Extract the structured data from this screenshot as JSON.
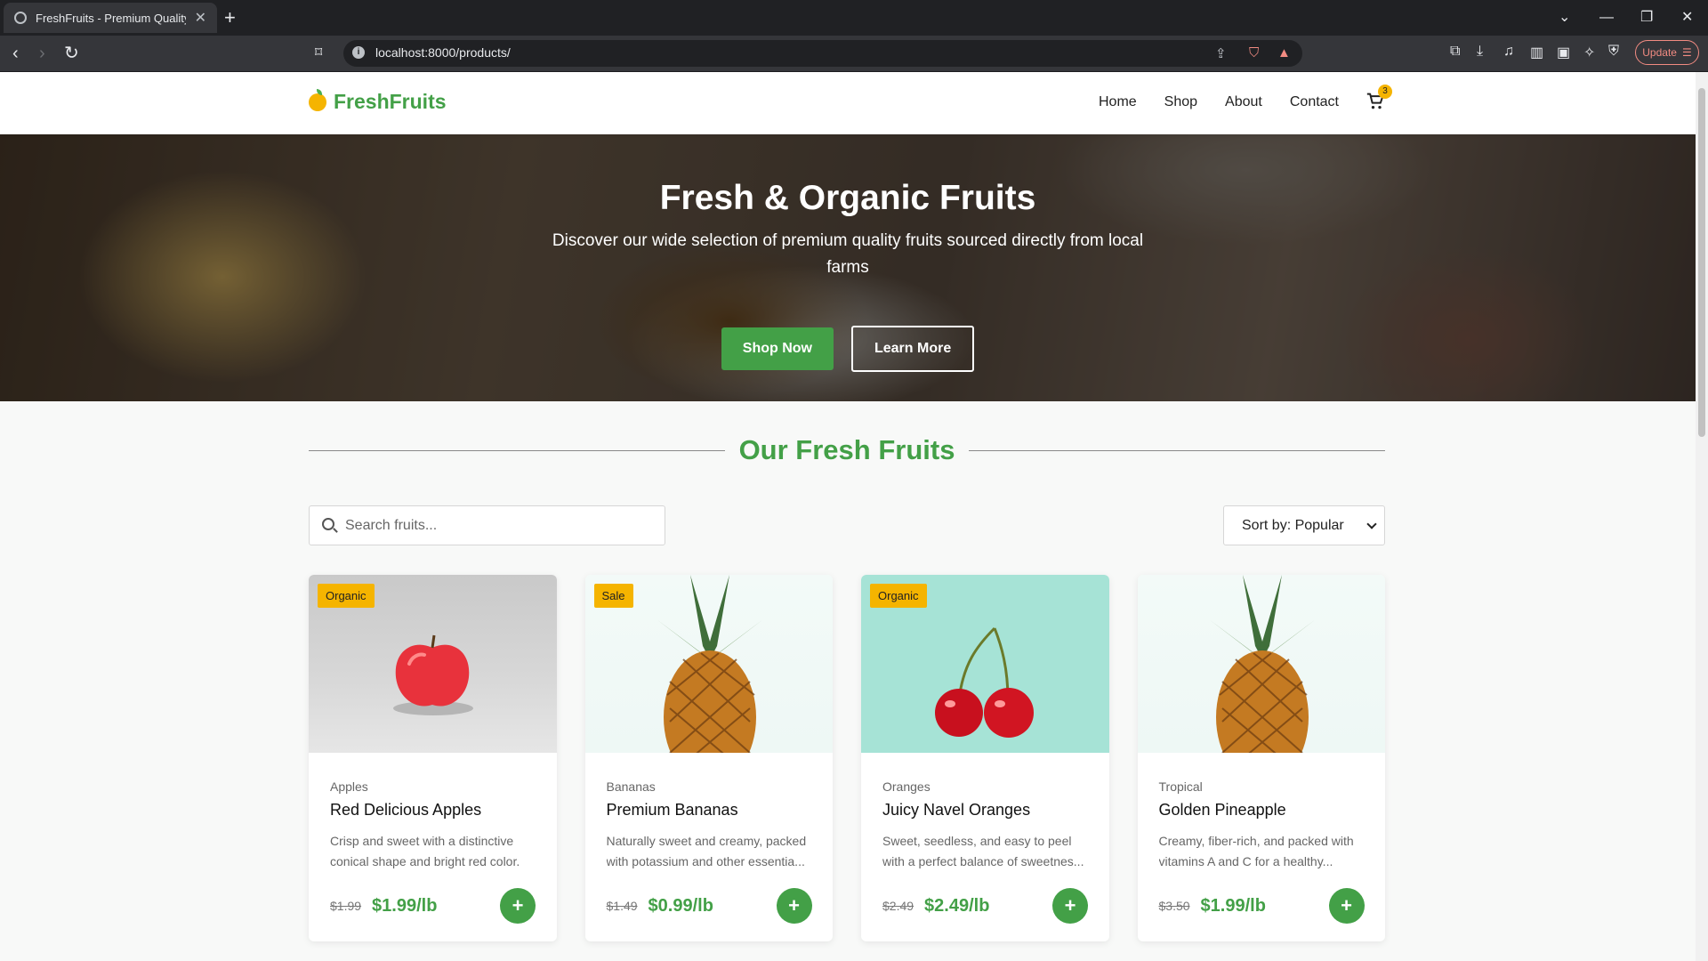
{
  "browser": {
    "tab_title": "FreshFruits - Premium Quality F",
    "url": "localhost:8000/products/",
    "update_label": "Update"
  },
  "site": {
    "logo": "FreshFruits",
    "nav": [
      "Home",
      "Shop",
      "About",
      "Contact"
    ],
    "cart_count": "3"
  },
  "hero": {
    "title": "Fresh & Organic Fruits",
    "subtitle": "Discover our wide selection of premium quality fruits sourced directly from local farms",
    "primary_button": "Shop Now",
    "secondary_button": "Learn More"
  },
  "products_section": {
    "title": "Our Fresh Fruits",
    "search_placeholder": "Search fruits...",
    "sort_label": "Sort by: Popular"
  },
  "products": [
    {
      "badge": "Organic",
      "category": "Apples",
      "name": "Red Delicious Apples",
      "description": "Crisp and sweet with a distinctive conical shape and bright red color.",
      "old_price": "$1.99",
      "price": "$1.99/lb",
      "add_label": "+"
    },
    {
      "badge": "Sale",
      "category": "Bananas",
      "name": "Premium Bananas",
      "description": "Naturally sweet and creamy, packed with potassium and other essentia...",
      "old_price": "$1.49",
      "price": "$0.99/lb",
      "add_label": "+"
    },
    {
      "badge": "Organic",
      "category": "Oranges",
      "name": "Juicy Navel Oranges",
      "description": "Sweet, seedless, and easy to peel with a perfect balance of sweetnes...",
      "old_price": "$2.49",
      "price": "$2.49/lb",
      "add_label": "+"
    },
    {
      "badge": "",
      "category": "Tropical",
      "name": "Golden Pineapple",
      "description": "Creamy, fiber-rich, and packed with vitamins A and C for a healthy...",
      "old_price": "$3.50",
      "price": "$1.99/lb",
      "add_label": "+"
    }
  ],
  "colors": {
    "brand_green": "#43a047",
    "badge_yellow": "#f5b400"
  }
}
